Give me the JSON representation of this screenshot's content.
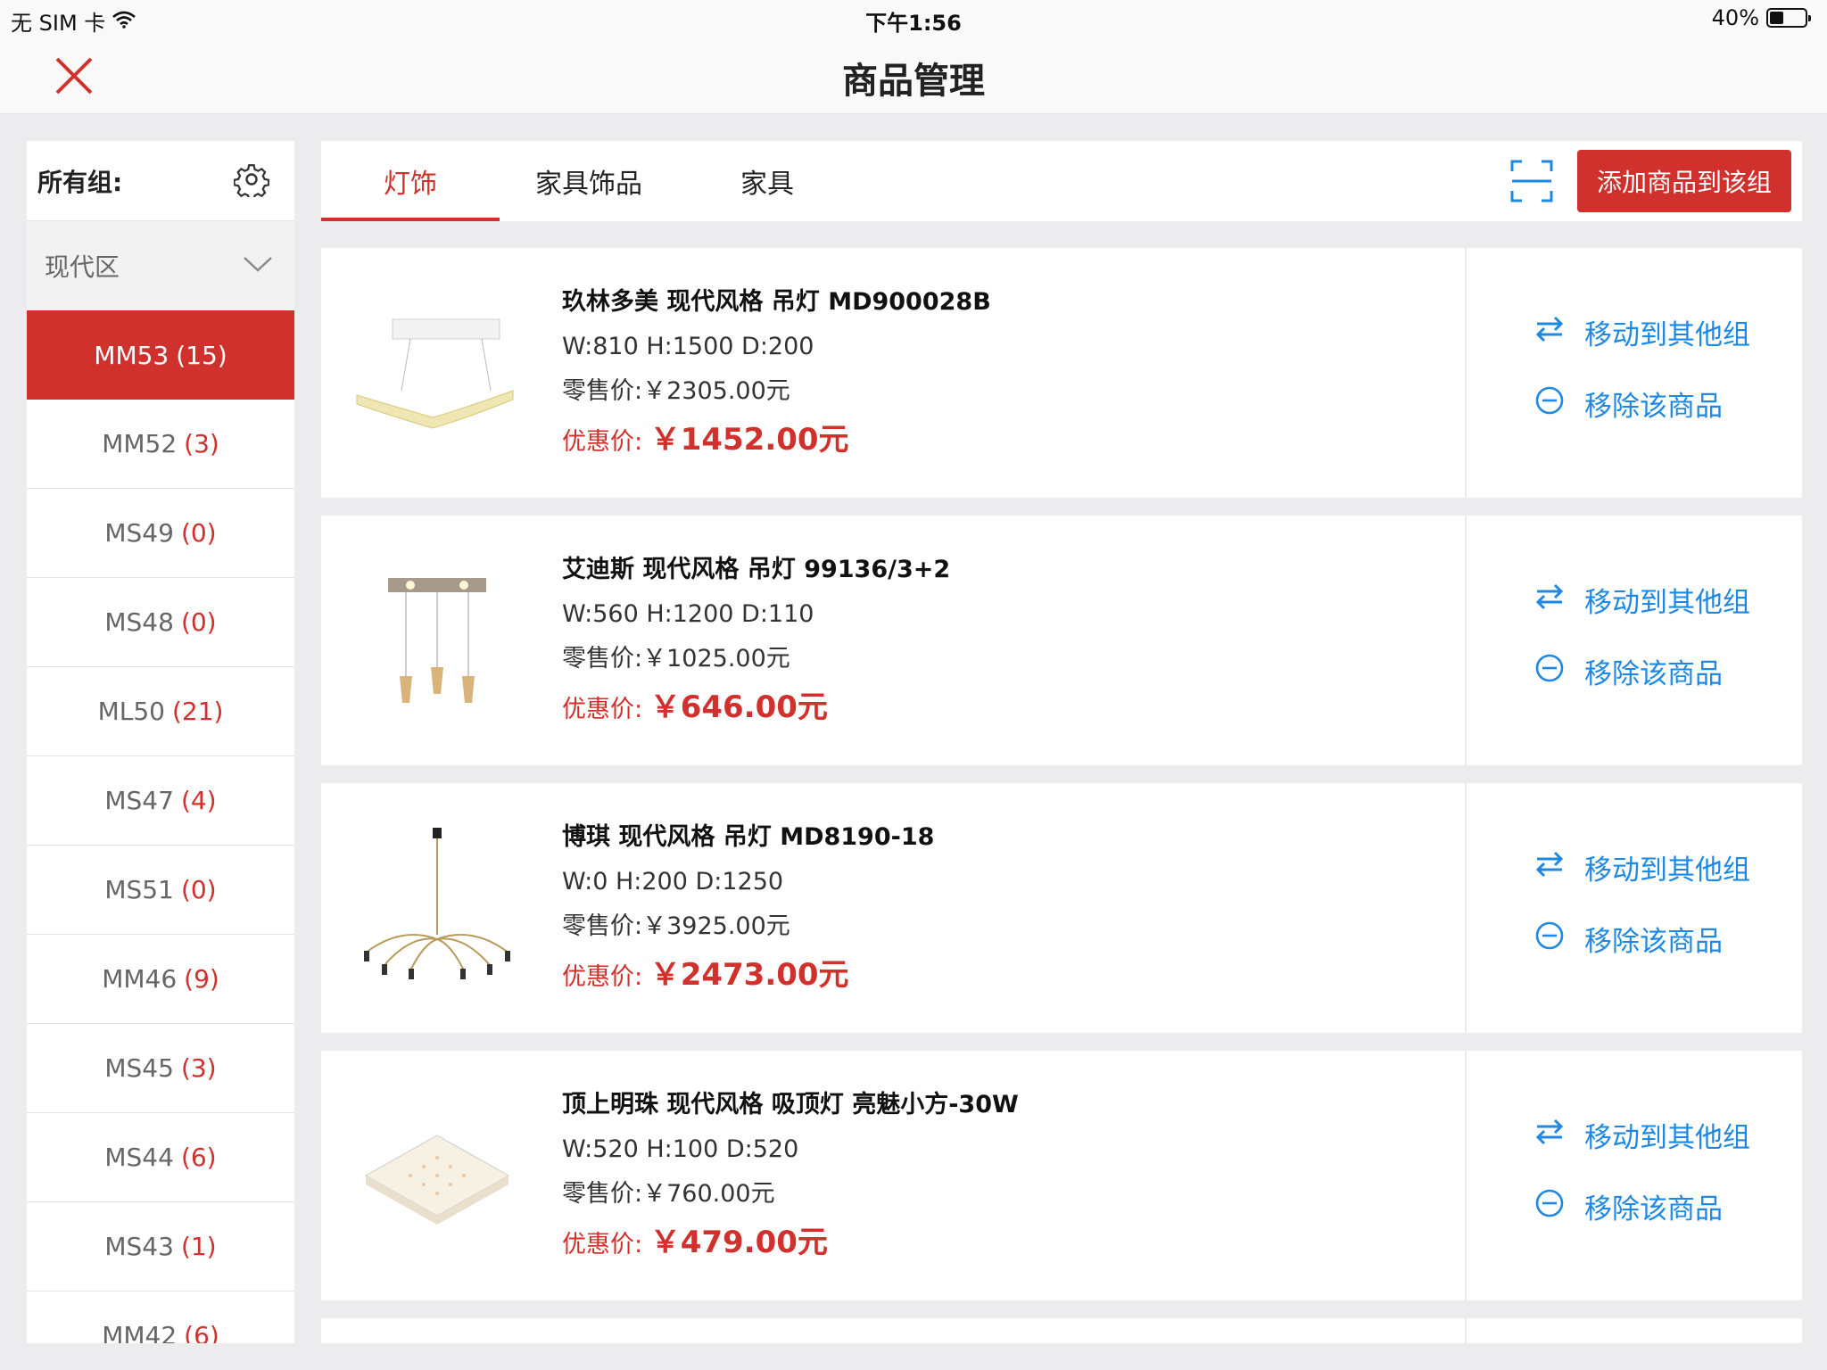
{
  "status_bar": {
    "carrier": "无 SIM 卡",
    "time": "下午1:56",
    "battery": "40%",
    "battery_level": 0.4
  },
  "nav": {
    "title": "商品管理",
    "close_icon": "close-icon"
  },
  "sidebar": {
    "header_label": "所有组:",
    "settings_icon": "gear-icon",
    "group_select": "现代区",
    "items": [
      {
        "name": "MM53",
        "count": "(15)"
      },
      {
        "name": "MM52",
        "count": "(3)"
      },
      {
        "name": "MS49",
        "count": "(0)"
      },
      {
        "name": "MS48",
        "count": "(0)"
      },
      {
        "name": "ML50",
        "count": "(21)"
      },
      {
        "name": "MS47",
        "count": "(4)"
      },
      {
        "name": "MS51",
        "count": "(0)"
      },
      {
        "name": "MM46",
        "count": "(9)"
      },
      {
        "name": "MS45",
        "count": "(3)"
      },
      {
        "name": "MS44",
        "count": "(6)"
      },
      {
        "name": "MS43",
        "count": "(1)"
      },
      {
        "name": "MM42",
        "count": "(6)"
      }
    ]
  },
  "tabs": [
    {
      "label": "灯饰"
    },
    {
      "label": "家具饰品"
    },
    {
      "label": "家具"
    }
  ],
  "toolbar": {
    "scan_icon": "scan-icon",
    "add_button": "添加商品到该组"
  },
  "actions": {
    "move_label": "移动到其他组",
    "remove_label": "移除该商品"
  },
  "products": [
    {
      "name": "玖林多美 现代风格 吊灯 MD900028B",
      "dims": "W:810 H:1500 D:200",
      "retail_label": "零售价:",
      "retail_price": "￥2305.00元",
      "promo_label": "优惠价:",
      "promo_price": "￥1452.00元"
    },
    {
      "name": "艾迪斯 现代风格 吊灯 99136/3+2",
      "dims": "W:560 H:1200 D:110",
      "retail_label": "零售价:",
      "retail_price": "￥1025.00元",
      "promo_label": "优惠价:",
      "promo_price": "￥646.00元"
    },
    {
      "name": "博琪 现代风格 吊灯 MD8190-18",
      "dims": "W:0 H:200 D:1250",
      "retail_label": "零售价:",
      "retail_price": "￥3925.00元",
      "promo_label": "优惠价:",
      "promo_price": "￥2473.00元"
    },
    {
      "name": "顶上明珠 现代风格 吸顶灯 亮魅小方-30W",
      "dims": "W:520 H:100 D:520",
      "retail_label": "零售价:",
      "retail_price": "￥760.00元",
      "promo_label": "优惠价:",
      "promo_price": "￥479.00元"
    }
  ],
  "colors": {
    "accent": "#d0312d",
    "action_blue": "#1e88e5",
    "background": "#ececee"
  }
}
